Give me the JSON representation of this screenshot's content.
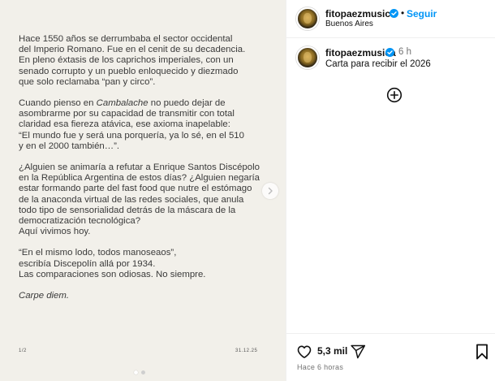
{
  "post": {
    "slide": {
      "paragraphs": [
        {
          "lines": [
            "Hace 1550 años se derrumbaba el sector occidental",
            "del Imperio Romano. Fue en el cenit de su decadencia.",
            "En pleno éxtasis de los caprichos imperiales, con un",
            "senado corrupto y un pueblo enloquecido y diezmado",
            "que solo reclamaba “pan y circo”."
          ]
        },
        {
          "lines": [
            "Cuando pienso en Cambalache no puedo dejar de",
            "asombrarme por su capacidad de transmitir con total",
            "claridad esa fiereza atávica, ese axioma inapelable:",
            "“El mundo fue y será una porquería, ya lo sé, en el 510",
            "y en el 2000 también…”."
          ]
        },
        {
          "lines": [
            "¿Alguien se animaría a refutar a Enrique Santos Discépolo",
            "en la República Argentina de estos días? ¿Alguien negaría",
            "estar formando parte del fast food que nutre el estómago",
            "de la anaconda virtual de las redes sociales, que anula",
            "todo tipo de sensorialidad detrás de la máscara de la",
            "democratización tecnológica?",
            "Aquí vivimos hoy."
          ]
        },
        {
          "lines": [
            "“En el mismo lodo, todos manoseaos”,",
            "escribía Discepolín allá por 1934.",
            "Las comparaciones son odiosas. No siempre."
          ]
        },
        {
          "lines": [
            "Carpe diem."
          ]
        }
      ],
      "page_indicator": "1/2",
      "date": "31.12.25"
    },
    "carousel_total": 2,
    "carousel_active": 1
  },
  "header": {
    "username": "fitopaezmusica",
    "separator": "•",
    "follow_label": "Seguir",
    "location": "Buenos Aires"
  },
  "caption": {
    "username": "fitopaezmusica",
    "time_ago": "6 h",
    "text": "Carta para recibir el 2026"
  },
  "actions": {
    "likes": "5,3 mil",
    "timestamp": "Hace 6 horas"
  },
  "colors": {
    "accent": "#0095f6",
    "verified": "#0095f6",
    "slide_bg": "#f2f0ea"
  }
}
